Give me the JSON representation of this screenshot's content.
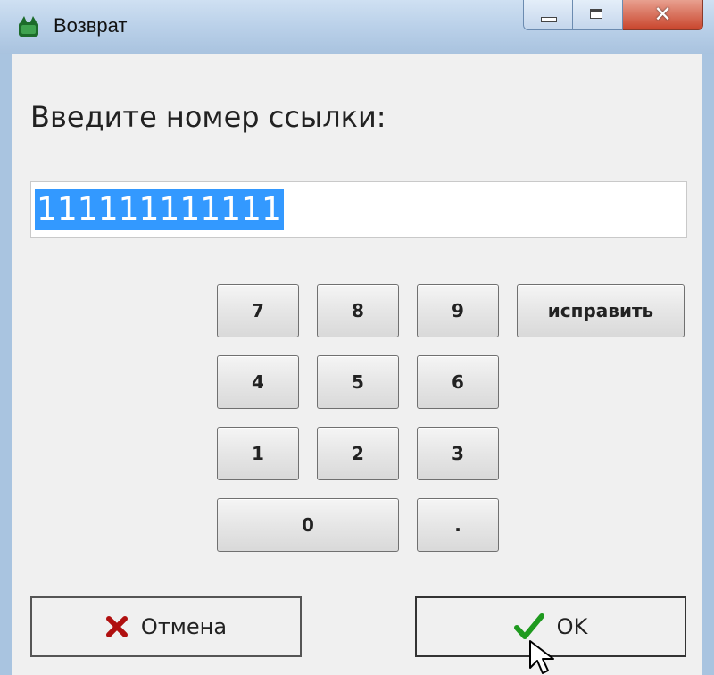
{
  "window": {
    "title": "Возврат",
    "controls": {
      "minimize": "minimize",
      "maximize": "maximize",
      "close": "✕"
    }
  },
  "dialog": {
    "prompt": "Введите номер ссылки:",
    "input_value": "111111111111"
  },
  "keypad": {
    "k7": "7",
    "k8": "8",
    "k9": "9",
    "correct": "исправить",
    "k4": "4",
    "k5": "5",
    "k6": "6",
    "k1": "1",
    "k2": "2",
    "k3": "3",
    "k0": "0",
    "dot": "."
  },
  "buttons": {
    "cancel_label": "Отмена",
    "ok_label": "OK"
  },
  "icons": {
    "app": "green-app-icon",
    "cancel": "red-x-icon",
    "ok": "green-check-icon",
    "cursor": "mouse-pointer-icon"
  },
  "colors": {
    "selection": "#3399ff",
    "cancel_icon": "#b01010",
    "ok_icon": "#1f9a1f"
  }
}
